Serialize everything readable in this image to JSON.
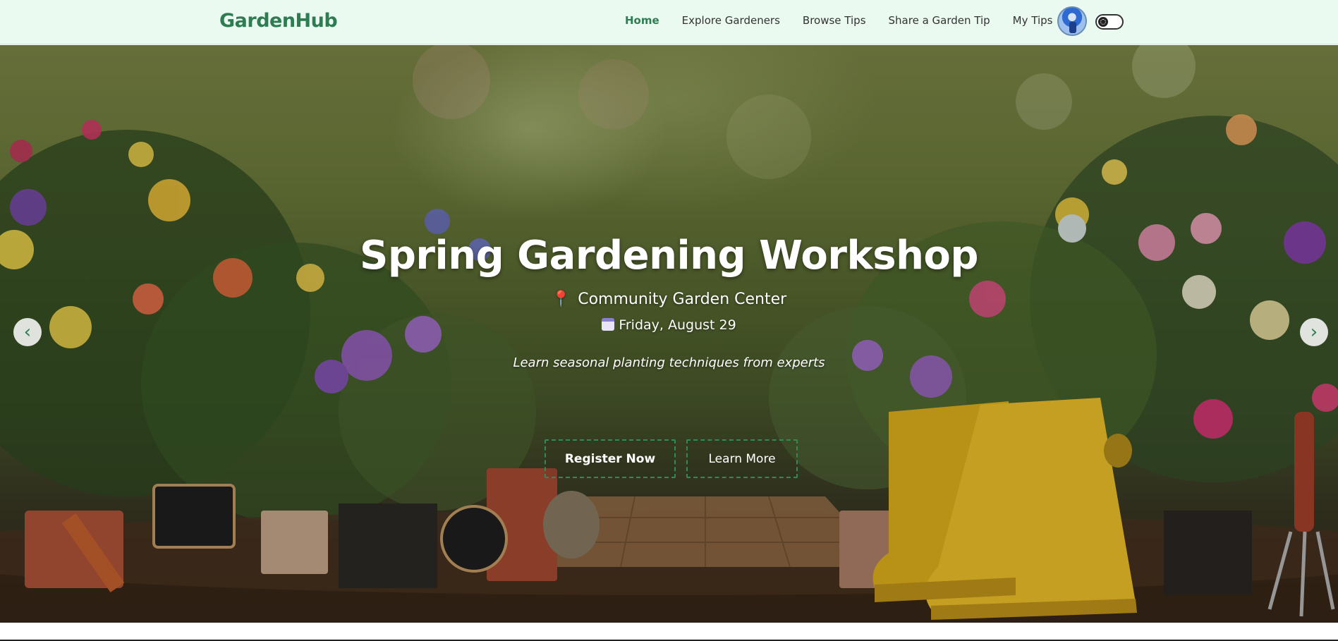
{
  "navbar": {
    "brand": "GardenHub",
    "links": [
      {
        "label": "Home",
        "active": true
      },
      {
        "label": "Explore Gardeners",
        "active": false
      },
      {
        "label": "Browse Tips",
        "active": false
      },
      {
        "label": "Share a Garden Tip",
        "active": false
      },
      {
        "label": "My Tips",
        "active": false
      }
    ],
    "avatar_icon": "user-avatar",
    "theme_toggle_icon": "theme-toggle"
  },
  "hero": {
    "title": "Spring Gardening Workshop",
    "location_icon": "map-pin-icon",
    "location": "Community Garden Center",
    "date_icon": "calendar-icon",
    "date": "Friday, August 29",
    "tagline": "Learn seasonal planting techniques from experts",
    "primary_button": "Register Now",
    "secondary_button": "Learn More",
    "prev_icon": "chevron-left-icon",
    "next_icon": "chevron-right-icon"
  },
  "colors": {
    "brand": "#2e7d52",
    "navbar_bg": "#ebfaf0",
    "button_border": "#2f8a57"
  }
}
